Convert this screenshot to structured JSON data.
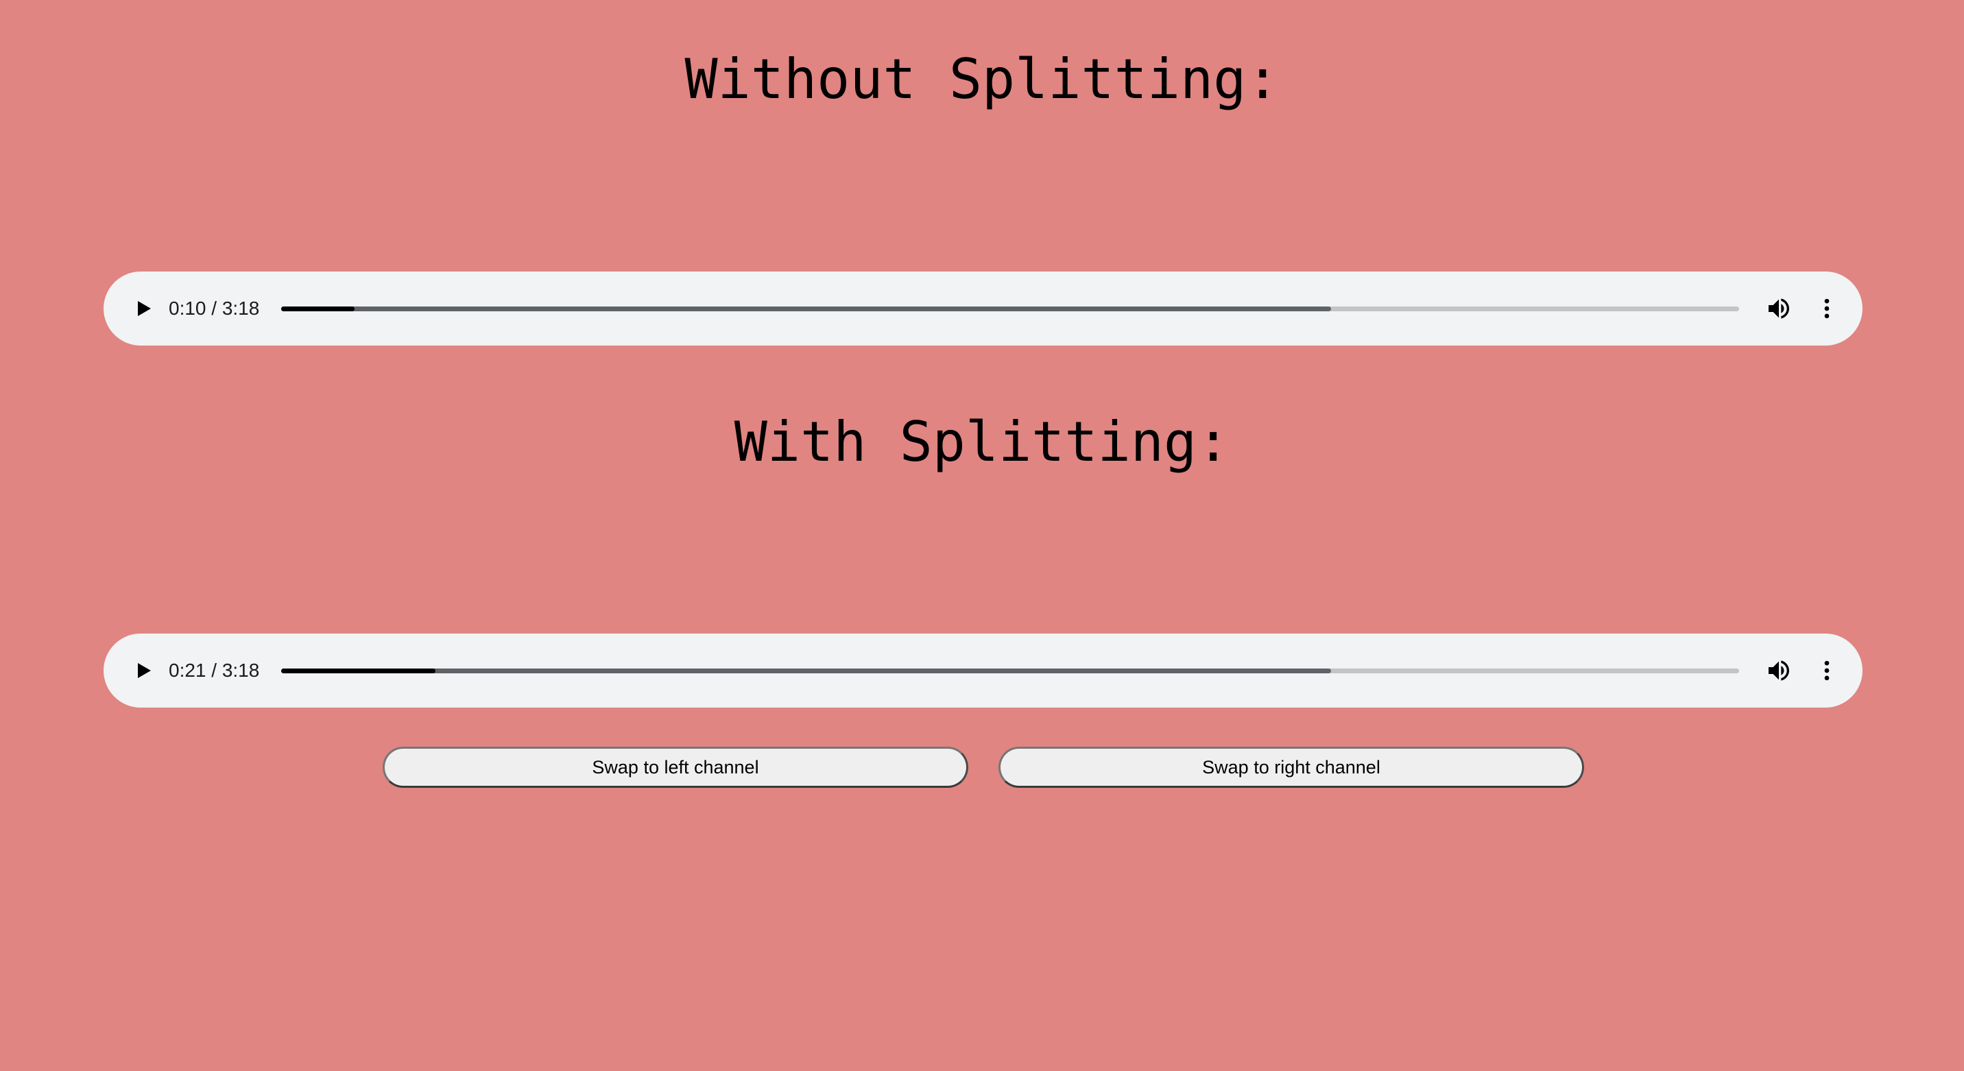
{
  "sections": {
    "without": {
      "heading": "Without Splitting:",
      "player": {
        "time": "0:10 / 3:18",
        "current_seconds": 10,
        "duration_seconds": 198,
        "buffered_fraction": 0.72,
        "play_icon": "play-icon",
        "volume_icon": "volume-icon",
        "menu_icon": "more-vert-icon"
      }
    },
    "with": {
      "heading": "With Splitting:",
      "player": {
        "time": "0:21 / 3:18",
        "current_seconds": 21,
        "duration_seconds": 198,
        "buffered_fraction": 0.72,
        "play_icon": "play-icon",
        "volume_icon": "volume-icon",
        "menu_icon": "more-vert-icon"
      }
    }
  },
  "buttons": {
    "swap_left": "Swap to left channel",
    "swap_right": "Swap to right channel"
  },
  "colors": {
    "background": "#e08582",
    "player_bg": "#f1f3f4",
    "track_played": "#000000",
    "track_buffered": "#5f6368",
    "track_rest": "#c4c4c4"
  }
}
